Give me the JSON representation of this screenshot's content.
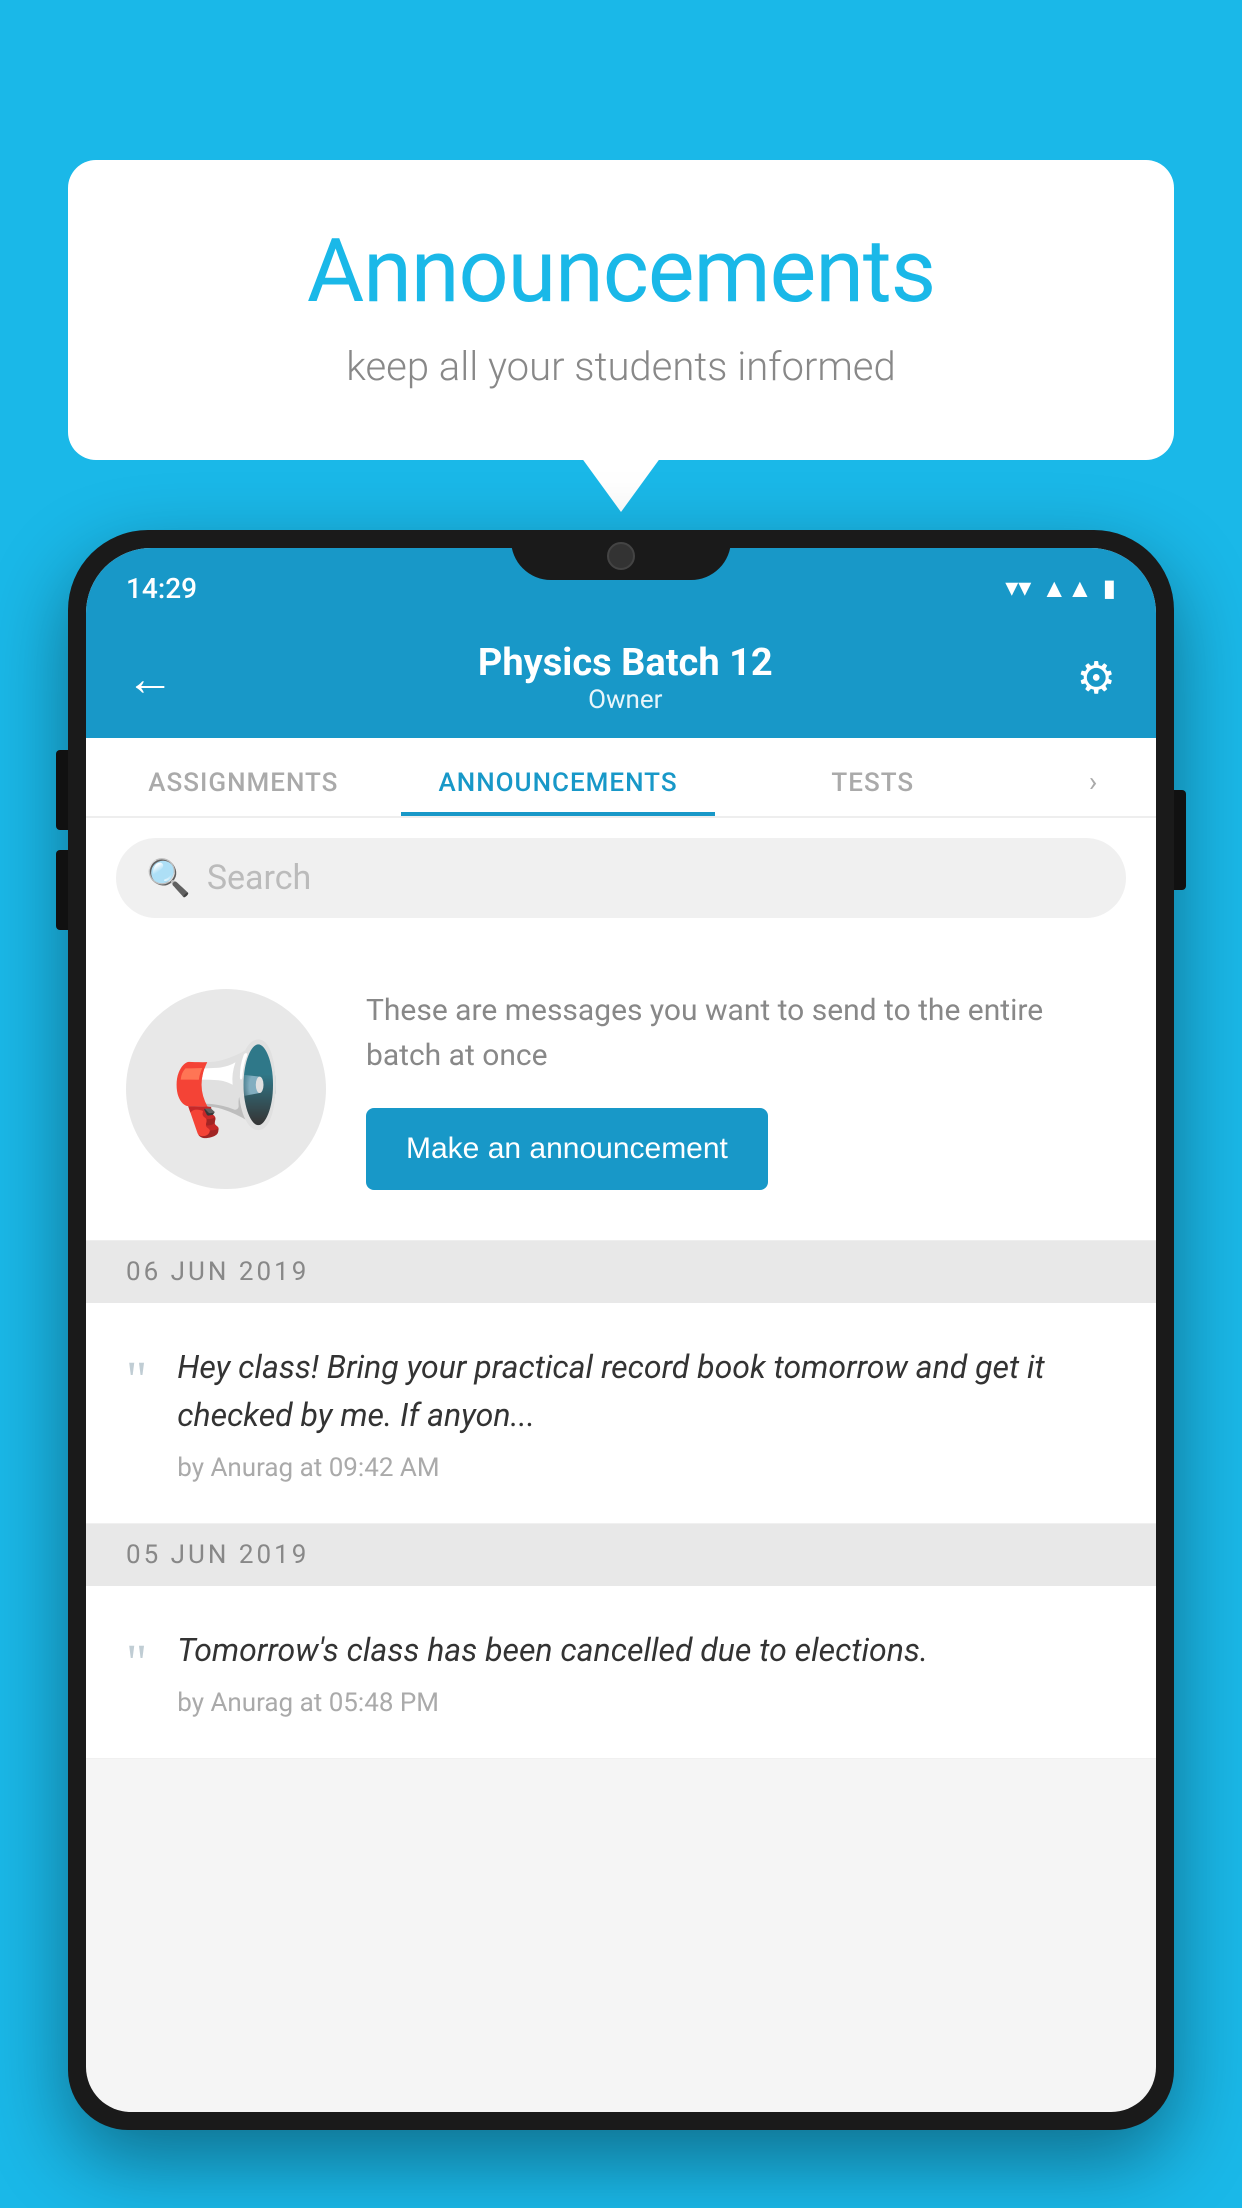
{
  "background_color": "#1ab8e8",
  "speech_bubble": {
    "title": "Announcements",
    "subtitle": "keep all your students informed"
  },
  "phone": {
    "status_bar": {
      "time": "14:29",
      "icons": [
        "wifi",
        "signal",
        "battery"
      ]
    },
    "header": {
      "title": "Physics Batch 12",
      "subtitle": "Owner",
      "back_label": "←",
      "settings_label": "⚙"
    },
    "tabs": [
      {
        "label": "ASSIGNMENTS",
        "active": false
      },
      {
        "label": "ANNOUNCEMENTS",
        "active": true
      },
      {
        "label": "TESTS",
        "active": false
      }
    ],
    "search": {
      "placeholder": "Search"
    },
    "announcement_prompt": {
      "description": "These are messages you want to send to the entire batch at once",
      "button_label": "Make an announcement"
    },
    "announcements": [
      {
        "date": "06  JUN  2019",
        "text": "Hey class! Bring your practical record book tomorrow and get it checked by me. If anyon...",
        "meta": "by Anurag at 09:42 AM"
      },
      {
        "date": "05  JUN  2019",
        "text": "Tomorrow's class has been cancelled due to elections.",
        "meta": "by Anurag at 05:48 PM"
      }
    ]
  }
}
